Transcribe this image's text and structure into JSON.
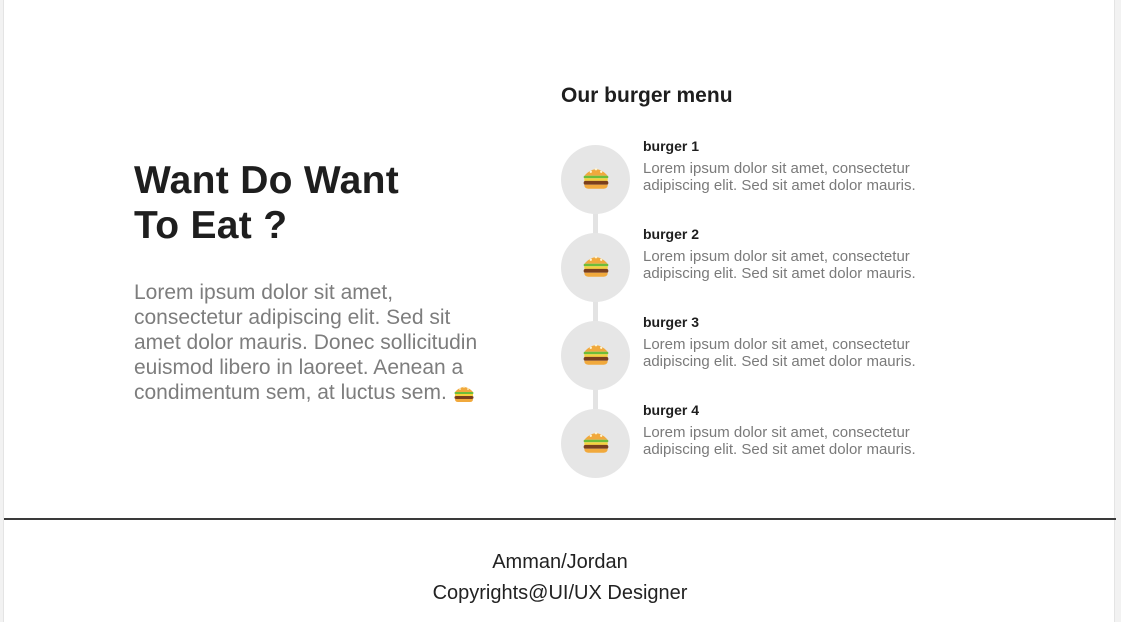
{
  "hero": {
    "title_line1": "Want Do Want",
    "title_line2": "To Eat ?",
    "text": "Lorem ipsum dolor sit amet, consectetur adipiscing elit. Sed sit amet dolor mauris. Donec sollicitudin euismod libero in laoreet. Aenean a condimentum sem, at luctus sem."
  },
  "menu": {
    "title": "Our burger menu",
    "items": [
      {
        "name": "burger 1",
        "description_line1": "Lorem ipsum dolor sit amet, consectetur",
        "description_line2": "adipiscing elit. Sed sit amet dolor mauris.",
        "icon": "burger-icon"
      },
      {
        "name": "burger 2",
        "description_line1": "Lorem ipsum dolor sit amet, consectetur",
        "description_line2": "adipiscing elit. Sed sit amet dolor mauris.",
        "icon": "burger-icon"
      },
      {
        "name": "burger 3",
        "description_line1": "Lorem ipsum dolor sit amet, consectetur",
        "description_line2": "adipiscing elit. Sed sit amet dolor mauris.",
        "icon": "burger-icon"
      },
      {
        "name": "burger 4",
        "description_line1": "Lorem ipsum dolor sit amet, consectetur",
        "description_line2": "adipiscing elit. Sed sit amet dolor mauris.",
        "icon": "burger-icon"
      }
    ]
  },
  "footer": {
    "location": "Amman/Jordan",
    "copyright": "Copyrights@UI/UX Designer"
  },
  "colors": {
    "heading": "#1e1e1e",
    "body_text": "#7d7d7d",
    "circle": "#e6e6e6",
    "footer_rule": "#3a3a3a"
  }
}
